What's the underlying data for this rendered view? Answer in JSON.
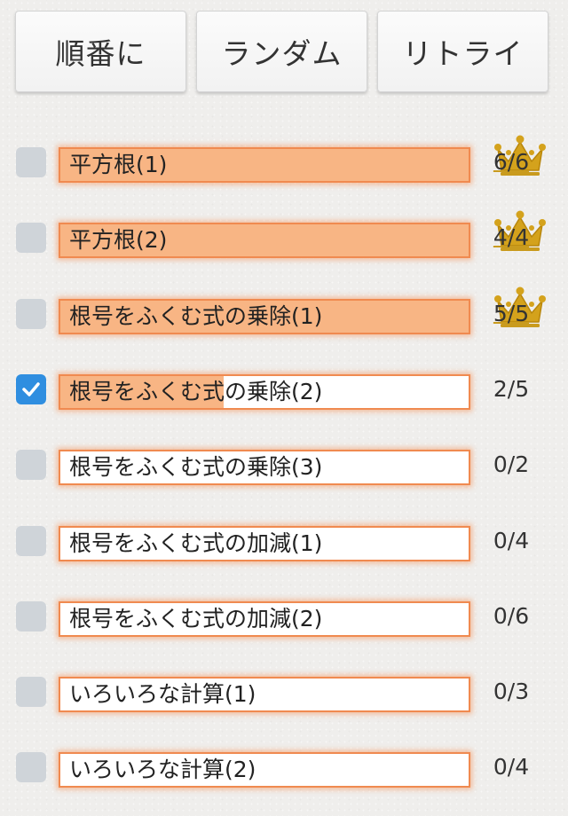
{
  "toolbar": {
    "sequential_label": "順番に",
    "random_label": "ランダム",
    "retry_label": "リトライ"
  },
  "colors": {
    "accent_orange": "#f08a50",
    "progress_fill": "#f8b584",
    "checkbox_checked": "#2f8ee0",
    "crown_gold": "#d4a21c"
  },
  "lessons": [
    {
      "title": "平方根(1)",
      "score": "6/6",
      "checked": false,
      "progress": 1.0,
      "crown": true
    },
    {
      "title": "平方根(2)",
      "score": "4/4",
      "checked": false,
      "progress": 1.0,
      "crown": true
    },
    {
      "title": "根号をふくむ式の乗除(1)",
      "score": "5/5",
      "checked": false,
      "progress": 1.0,
      "crown": true
    },
    {
      "title": "根号をふくむ式の乗除(2)",
      "score": "2/5",
      "checked": true,
      "progress": 0.4,
      "crown": false
    },
    {
      "title": "根号をふくむ式の乗除(3)",
      "score": "0/2",
      "checked": false,
      "progress": 0,
      "crown": false
    },
    {
      "title": "根号をふくむ式の加減(1)",
      "score": "0/4",
      "checked": false,
      "progress": 0,
      "crown": false
    },
    {
      "title": "根号をふくむ式の加減(2)",
      "score": "0/6",
      "checked": false,
      "progress": 0,
      "crown": false
    },
    {
      "title": "いろいろな計算(1)",
      "score": "0/3",
      "checked": false,
      "progress": 0,
      "crown": false
    },
    {
      "title": "いろいろな計算(2)",
      "score": "0/4",
      "checked": false,
      "progress": 0,
      "crown": false
    }
  ]
}
